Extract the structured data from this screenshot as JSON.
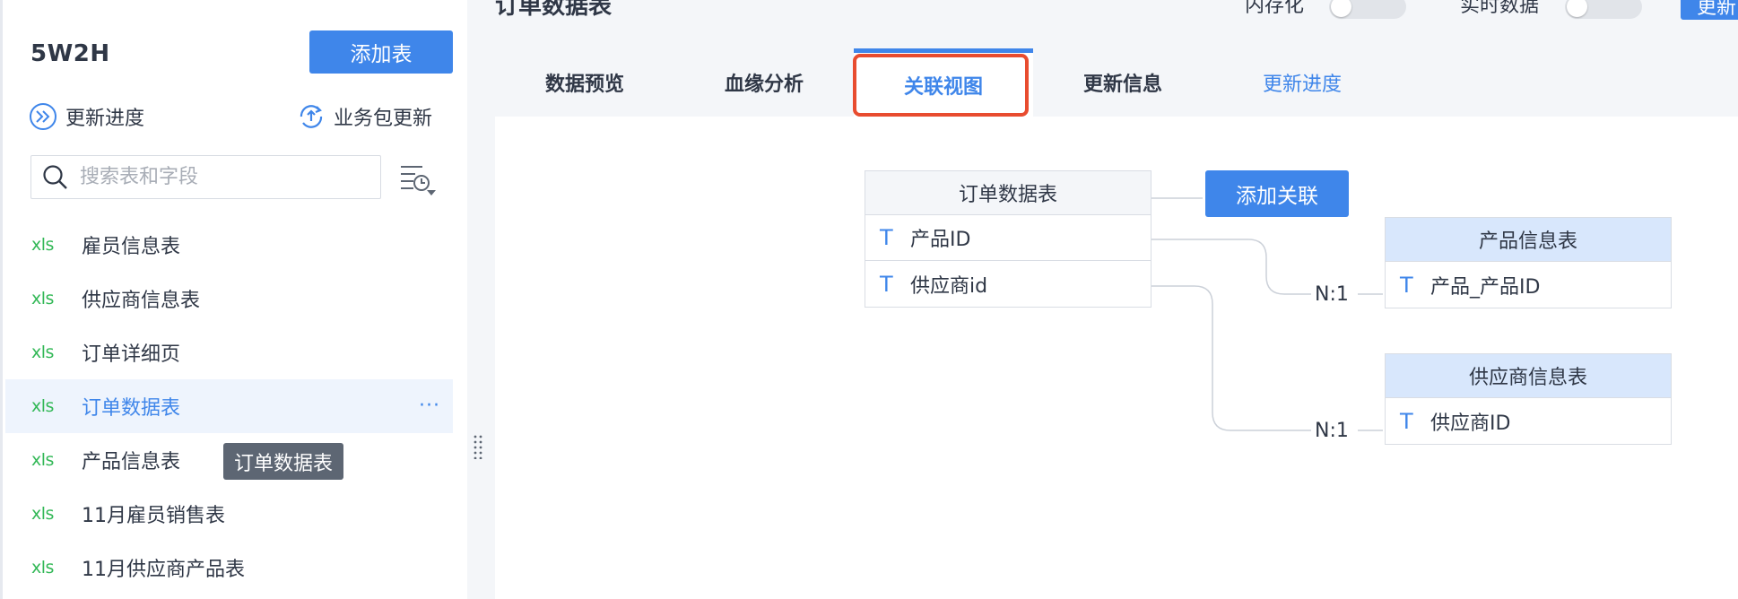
{
  "sidebar": {
    "project_title": "5W2H",
    "add_table_label": "添加表",
    "update_progress_label": "更新进度",
    "package_update_label": "业务包更新",
    "search_placeholder": "搜索表和字段",
    "tables": [
      {
        "icon": "xls",
        "name": "雇员信息表",
        "active": false
      },
      {
        "icon": "xls",
        "name": "供应商信息表",
        "active": false
      },
      {
        "icon": "xls",
        "name": "订单详细页",
        "active": false
      },
      {
        "icon": "xls",
        "name": "订单数据表",
        "active": true
      },
      {
        "icon": "xls",
        "name": "产品信息表",
        "active": false
      },
      {
        "icon": "xls",
        "name": "11月雇员销售表",
        "active": false
      },
      {
        "icon": "xls",
        "name": "11月供应商产品表",
        "active": false
      }
    ],
    "more_label": "···",
    "tooltip": "订单数据表"
  },
  "header": {
    "title": "订单数据表",
    "persist_label": "内存化",
    "realtime_label": "实时数据",
    "top_button_label": "更新"
  },
  "tabs": [
    {
      "label": "数据预览"
    },
    {
      "label": "血缘分析"
    },
    {
      "label": "关联视图"
    },
    {
      "label": "更新信息"
    },
    {
      "label": "更新进度"
    }
  ],
  "diagram": {
    "source": {
      "title": "订单数据表",
      "fields": [
        {
          "type_icon": "T",
          "name": "产品ID"
        },
        {
          "type_icon": "T",
          "name": "供应商id"
        }
      ]
    },
    "add_relation_label": "添加关联",
    "relations": [
      {
        "cardinality": "N:1",
        "table": "产品信息表",
        "field_icon": "T",
        "field": "产品_产品ID"
      },
      {
        "cardinality": "N:1",
        "table": "供应商信息表",
        "field_icon": "T",
        "field": "供应商ID"
      }
    ]
  },
  "colors": {
    "accent": "#3f86ea",
    "xls_green": "#33b857",
    "highlight_red": "#e84c2f",
    "panel_gray": "#f4f6f9"
  }
}
